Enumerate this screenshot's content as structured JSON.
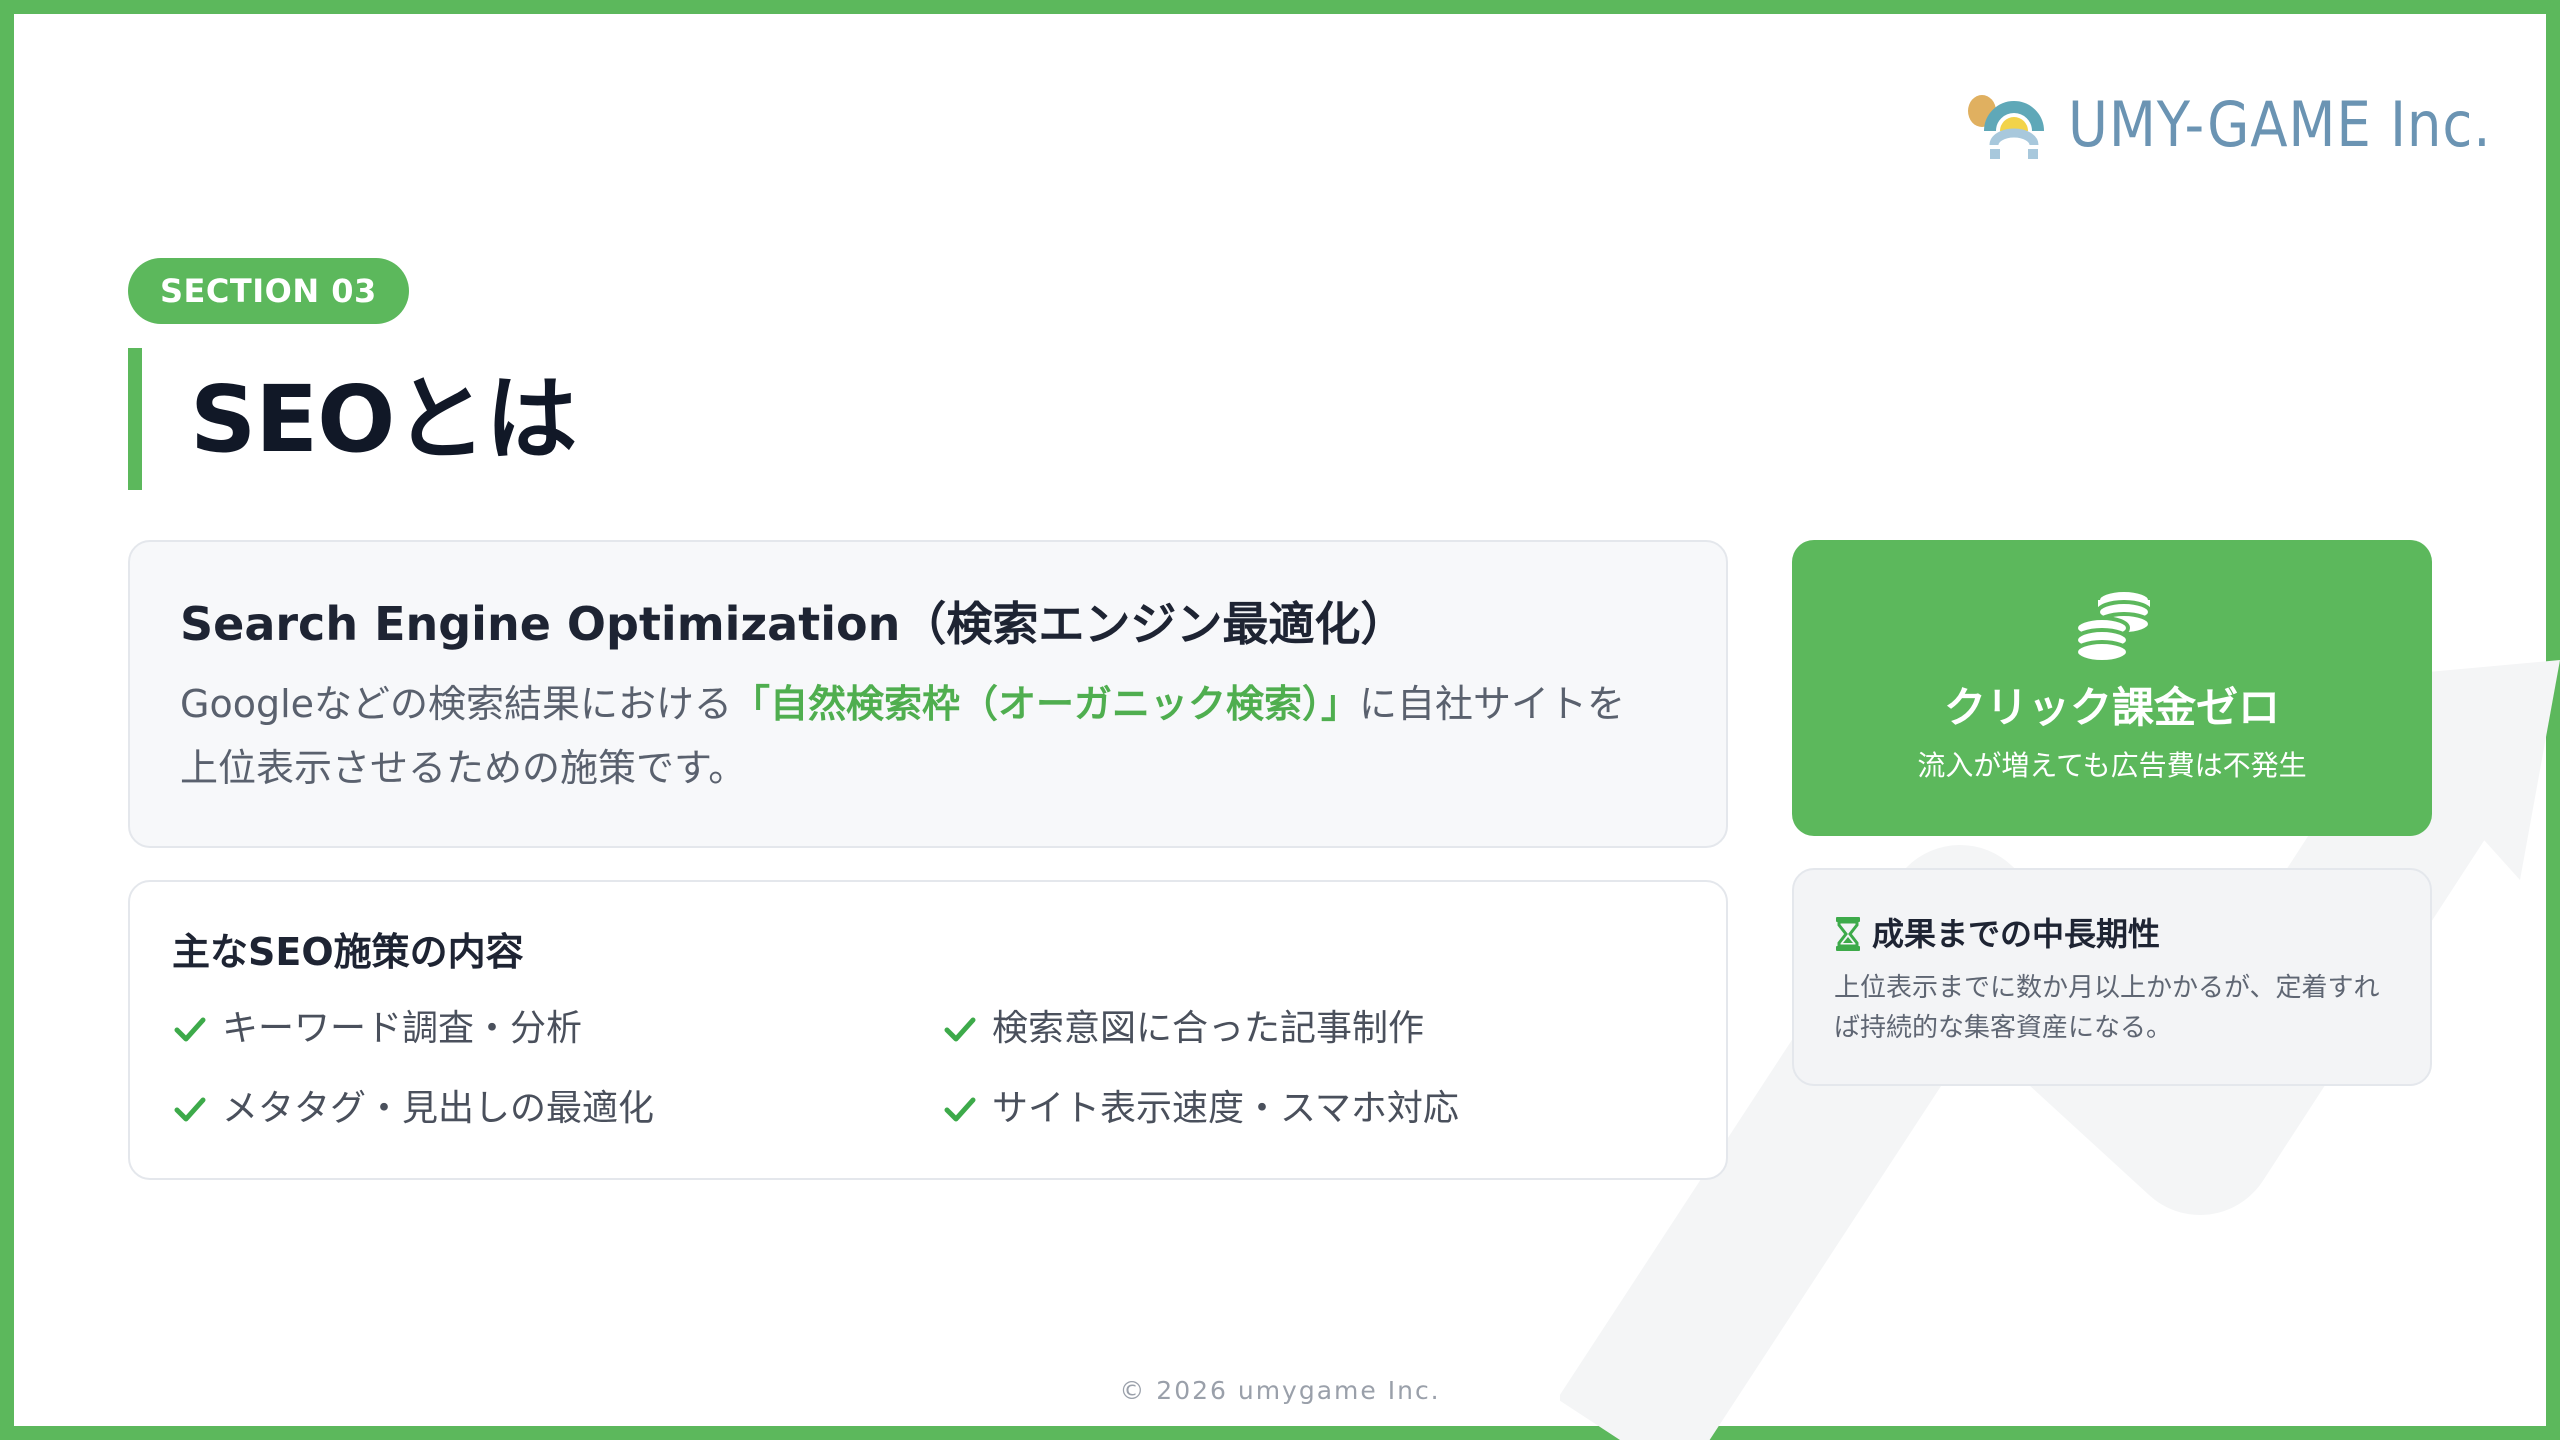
{
  "brand": {
    "name": "UMY-GAME Inc."
  },
  "section": {
    "label": "SECTION 03"
  },
  "title": "SEOとは",
  "definition": {
    "heading": "Search Engine Optimization（検索エンジン最適化）",
    "body_before": "Googleなどの検索結果における",
    "body_highlight": "「自然検索枠（オーガニック検索）」",
    "body_after": "に自社サイトを上位表示させるための施策です。"
  },
  "measures": {
    "heading": "主なSEO施策の内容",
    "items": [
      {
        "label": "キーワード調査・分析",
        "icon": "check-icon"
      },
      {
        "label": "検索意図に合った記事制作",
        "icon": "check-icon"
      },
      {
        "label": "メタタグ・見出しの最適化",
        "icon": "check-icon"
      },
      {
        "label": "サイト表示速度・スマホ対応",
        "icon": "check-icon"
      }
    ]
  },
  "benefit": {
    "icon": "coins-icon",
    "title": "クリック課金ゼロ",
    "subtitle": "流入が増えても広告費は不発生"
  },
  "note": {
    "icon": "hourglass-icon",
    "title": "成果までの中長期性",
    "body": "上位表示までに数か月以上かかるが、定着すれば持続的な集客資産になる。"
  },
  "footer": {
    "copyright": "© 2026 umygame Inc."
  },
  "colors": {
    "accent": "#5cb85c",
    "text": "#1e2433",
    "logo_text": "#6b94b3"
  }
}
